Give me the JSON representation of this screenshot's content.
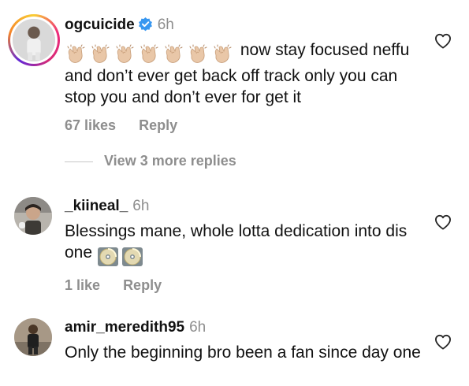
{
  "comments": [
    {
      "username": "ogcuicide",
      "verified": true,
      "time": "6h",
      "emojis": [
        "clapping-hands-icon",
        "clapping-hands-icon",
        "clapping-hands-icon",
        "clapping-hands-icon",
        "clapping-hands-icon",
        "clapping-hands-icon",
        "clapping-hands-icon"
      ],
      "text_line1": " now stay focused neffu",
      "text_rest": "and don’t ever get back off track only you can stop you and don’t ever for get it",
      "likes": "67 likes",
      "reply": "Reply"
    },
    {
      "username": "_kiineal_",
      "time": "6h",
      "text": "Blessings mane, whole lotta dedication into dis one",
      "emojis": [
        "cd-disc-icon",
        "cd-disc-icon"
      ],
      "likes": "1 like",
      "reply": "Reply"
    },
    {
      "username": "amir_meredith95",
      "time": "6h",
      "text": "Only the beginning bro been a fan since day one"
    }
  ],
  "view_replies": "View 3 more replies",
  "colors": {
    "muted": "#8e8e8e",
    "verified": "#3897f0",
    "text": "#111111"
  }
}
